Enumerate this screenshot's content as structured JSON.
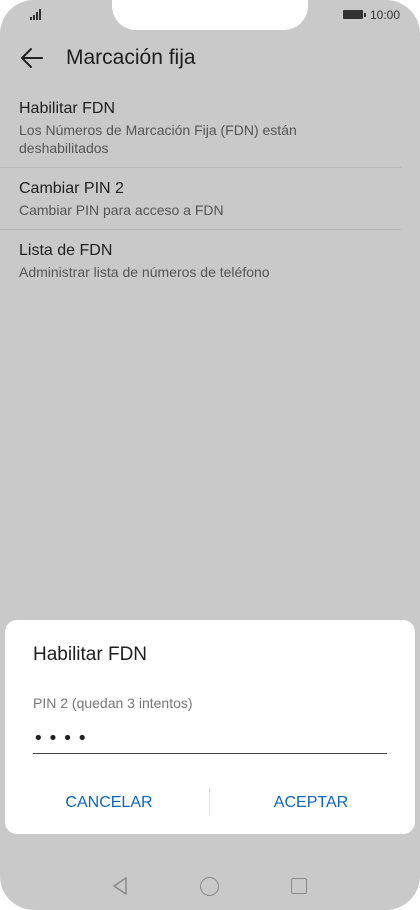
{
  "status_bar": {
    "time": "10:00"
  },
  "app_bar": {
    "title": "Marcación fija"
  },
  "list": {
    "items": [
      {
        "title": "Habilitar FDN",
        "subtitle": "Los Números de Marcación Fija (FDN) están deshabilitados"
      },
      {
        "title": "Cambiar PIN 2",
        "subtitle": "Cambiar PIN para acceso a FDN"
      },
      {
        "title": "Lista de FDN",
        "subtitle": "Administrar lista de números de teléfono"
      }
    ]
  },
  "dialog": {
    "title": "Habilitar FDN",
    "field_label": "PIN 2 (quedan 3 intentos)",
    "pin_value": "••••",
    "cancel_label": "CANCELAR",
    "accept_label": "ACEPTAR"
  },
  "colors": {
    "scrim_background": "#c9c9c9",
    "dialog_button": "#1166b8"
  },
  "icons": {
    "back": "arrow-left-icon",
    "nav_back": "triangle-back-icon",
    "nav_home": "circle-home-icon",
    "nav_recent": "square-recent-icon"
  }
}
